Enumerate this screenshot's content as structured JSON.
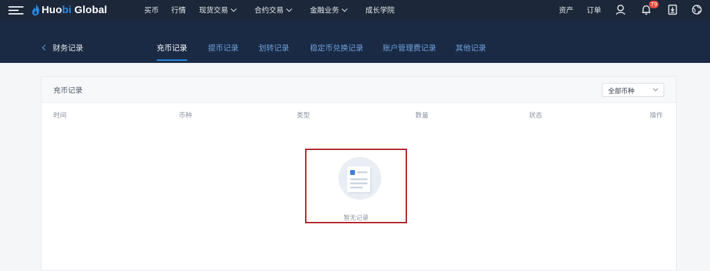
{
  "topnav": {
    "logo": {
      "prefix": "Huo",
      "accent": "bi",
      "suffix": " Global"
    },
    "items": [
      {
        "label": "买币",
        "dropdown": false
      },
      {
        "label": "行情",
        "dropdown": false
      },
      {
        "label": "现货交易",
        "dropdown": true
      },
      {
        "label": "合约交易",
        "dropdown": true
      },
      {
        "label": "金融业务",
        "dropdown": true
      },
      {
        "label": "成长学院",
        "dropdown": false
      }
    ],
    "right": {
      "assets": "资产",
      "orders": "订单",
      "notification_count": "79",
      "icons": [
        "user-icon",
        "bell-icon",
        "download-icon",
        "globe-icon"
      ]
    }
  },
  "subnav": {
    "back_label": "财务记录",
    "tabs": [
      {
        "label": "充币记录",
        "active": true
      },
      {
        "label": "提币记录",
        "active": false
      },
      {
        "label": "划转记录",
        "active": false
      },
      {
        "label": "稳定币兑换记录",
        "active": false
      },
      {
        "label": "账户管理费记录",
        "active": false
      },
      {
        "label": "其他记录",
        "active": false
      }
    ]
  },
  "records": {
    "title": "充币记录",
    "filter_value": "全部币种",
    "columns": [
      "时间",
      "币种",
      "类型",
      "数量",
      "状态",
      "操作"
    ],
    "empty_text": "暂无记录"
  },
  "colors": {
    "topbar": "#1c2739",
    "subnav": "#1b2a44",
    "accent": "#2a8be6",
    "tab_inactive": "#6ea0dc",
    "highlight_box": "#b21f24",
    "badge": "#e8453c"
  }
}
